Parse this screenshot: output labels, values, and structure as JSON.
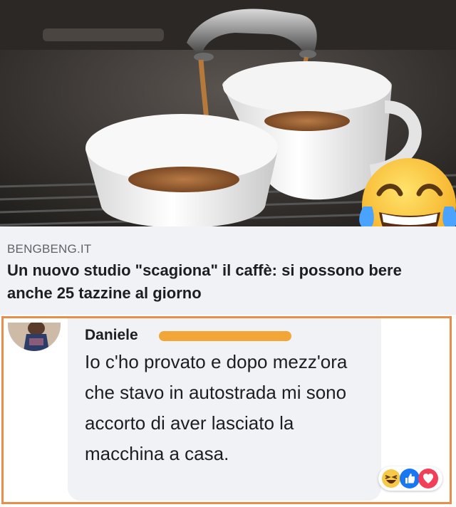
{
  "post": {
    "image": {
      "subject": "espresso-cups",
      "overlay_icon": "laughing-tears-emoji-icon"
    },
    "link_preview": {
      "domain": "BENGBENG.IT",
      "headline": "Un nuovo studio \"scagiona\" il caffè: si possono bere anche 25 tazzine al giorno"
    }
  },
  "comment": {
    "author": "Daniele",
    "author_redacted": true,
    "text": "Io c'ho provato e dopo mezz'ora che stavo in autostrada mi sono accorto di aver lasciato la macchina a casa.",
    "reactions": [
      "haha-icon",
      "like-icon",
      "love-icon"
    ]
  },
  "colors": {
    "frame_border": "#e88d4a",
    "redaction": "#f3a638",
    "preview_background": "#f0f2f5",
    "like_blue": "#1877f2",
    "love_red": "#f33e58"
  }
}
